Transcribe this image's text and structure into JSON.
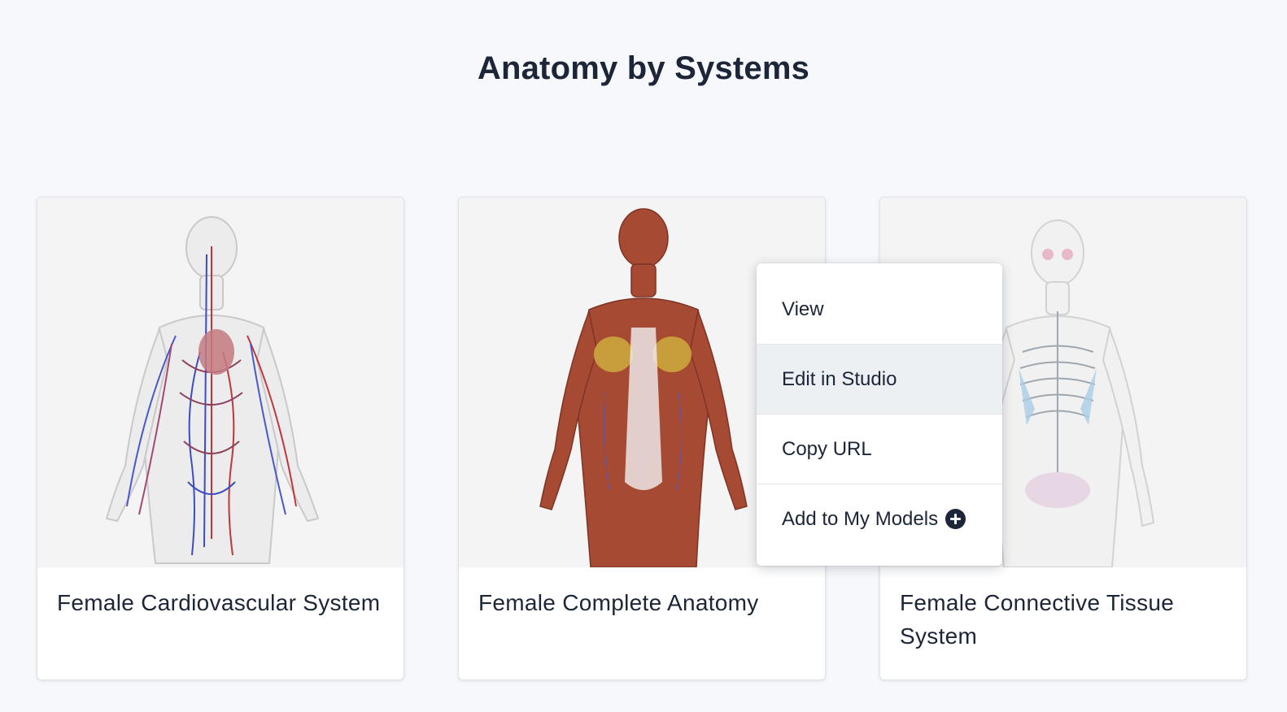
{
  "page": {
    "title": "Anatomy by Systems"
  },
  "cards": [
    {
      "title": "Female Cardiovascular System",
      "image": "female-cardiovascular-model"
    },
    {
      "title": "Female Complete Anatomy",
      "image": "female-complete-anatomy-model"
    },
    {
      "title": "Female Connective Tissue System",
      "image": "female-connective-tissue-model"
    }
  ],
  "context_menu": {
    "items": [
      {
        "label": "View",
        "active": false
      },
      {
        "label": "Edit in Studio",
        "active": true
      },
      {
        "label": "Copy URL",
        "active": false
      },
      {
        "label": "Add to My Models",
        "icon": "plus-circle-icon",
        "active": false
      }
    ]
  },
  "colors": {
    "background": "#f7f8fb",
    "text": "#1c2638",
    "menu_hover": "#edf0f3",
    "card_image_bg": "#f4f4f4"
  }
}
